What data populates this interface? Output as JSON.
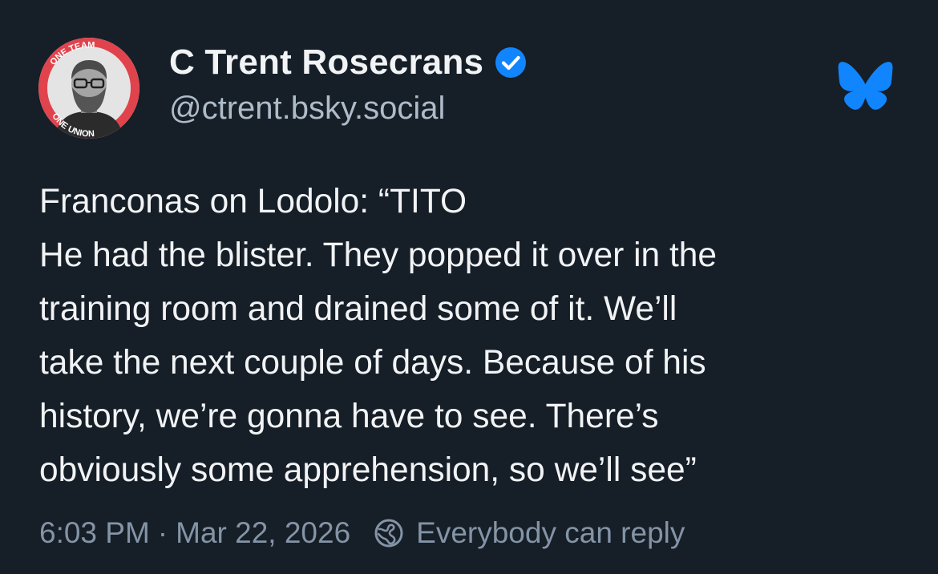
{
  "author": {
    "display_name": "C Trent Rosecrans",
    "handle": "@ctrent.bsky.social",
    "avatar_text_top": "ONE TEAM",
    "avatar_text_bottom": "ONE UNION",
    "verified": true
  },
  "post": {
    "lines": [
      "Franconas on Lodolo: “TITO",
      "He had the blister. They popped it over in the",
      "training room and drained some of it. We’ll",
      "take the next couple of days. Because of his",
      "history, we’re gonna have to see. There’s",
      "obviously some apprehension, so we’ll see”"
    ]
  },
  "meta": {
    "time": "6:03 PM",
    "separator": "·",
    "date": "Mar 22, 2026",
    "reply_setting": "Everybody can reply"
  },
  "icons": {
    "verified": "verified-check-icon",
    "brand": "bluesky-butterfly-icon",
    "reply": "globe-icon"
  },
  "colors": {
    "background": "#161e27",
    "text": "#f1f3f5",
    "muted": "#8494a6",
    "handle": "#aebbc9",
    "brand_blue": "#1185fe",
    "avatar_ring": "#e0434c"
  }
}
